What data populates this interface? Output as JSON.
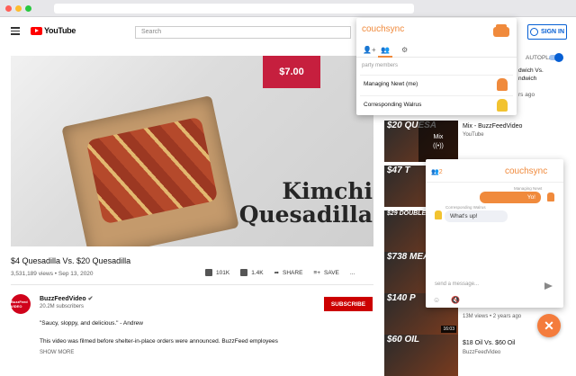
{
  "youtube": {
    "brand": "YouTube",
    "search_placeholder": "Search",
    "signin_label": "SIGN IN"
  },
  "video": {
    "price_tag": "$7.00",
    "overlay_title_line1": "Kimchi",
    "overlay_title_line2": "Quesadilla",
    "title": "$4 Quesadilla Vs. $20 Quesadilla",
    "views_date": "3,531,189 views • Sep 13, 2020",
    "likes": "101K",
    "dislikes": "1.4K",
    "share_label": "SHARE",
    "save_label": "SAVE",
    "more_label": "...",
    "channel": {
      "avatar_text": "BuzzFeed VIDEO",
      "name": "BuzzFeedVideo",
      "subscribers": "20.2M subscribers",
      "subscribe_label": "SUBSCRIBE"
    },
    "description_line1": "\"Saucy, sloppy, and delicious.\" - Andrew",
    "description_line2": "This video was filmed before shelter-in-place orders were announced. BuzzFeed employees",
    "show_more": "SHOW MORE"
  },
  "sidebar": {
    "autoplay_label": "AUTOPLAY",
    "peek_line1": "dwich Vs.",
    "peek_line2": "ndwich",
    "peek_line3": "rs ago",
    "items": [
      {
        "thumb_text": "$20 QUESA",
        "title": "Mix - BuzzFeedVideo",
        "sub": "YouTube",
        "mix_label": "Mix",
        "duration": ""
      },
      {
        "thumb_text": "$47 T",
        "title": "",
        "sub": "",
        "duration": ""
      },
      {
        "thumb_text": "$29 DOUBLE CHE",
        "title": "",
        "sub": "",
        "duration": ""
      },
      {
        "thumb_text": "$738 MEAT",
        "title": "",
        "sub": "",
        "duration": ""
      },
      {
        "thumb_text": "$140 P",
        "title": "13M views • 2 years ago",
        "sub": "",
        "duration": "16:03"
      },
      {
        "thumb_text": "$60 OIL",
        "title": "$18 Oil Vs. $60 Oil",
        "sub": "BuzzFeedVideo",
        "duration": ""
      }
    ]
  },
  "couchsync_popup": {
    "brand": "couchsync",
    "party_members_label": "party members",
    "members": [
      {
        "name": "Managing Newt (me)",
        "avatar_color": "#f08a3c"
      },
      {
        "name": "Corresponding Walrus",
        "avatar_color": "#f2c330"
      }
    ]
  },
  "couchsync_chat": {
    "brand": "couchsync",
    "member_count": "2",
    "messages": [
      {
        "sender": "Managing Newt",
        "text": "Yo!",
        "direction": "out"
      },
      {
        "sender": "Corresponding Walrus",
        "text": "What's up!",
        "direction": "in"
      }
    ],
    "input_placeholder": "send a message...",
    "close_label": "✕"
  },
  "colors": {
    "accent": "#f08a3c",
    "youtube_red": "#ff0000",
    "subscribe_red": "#cc0000",
    "price_red": "#c61f3e",
    "signin_blue": "#065fd4"
  }
}
